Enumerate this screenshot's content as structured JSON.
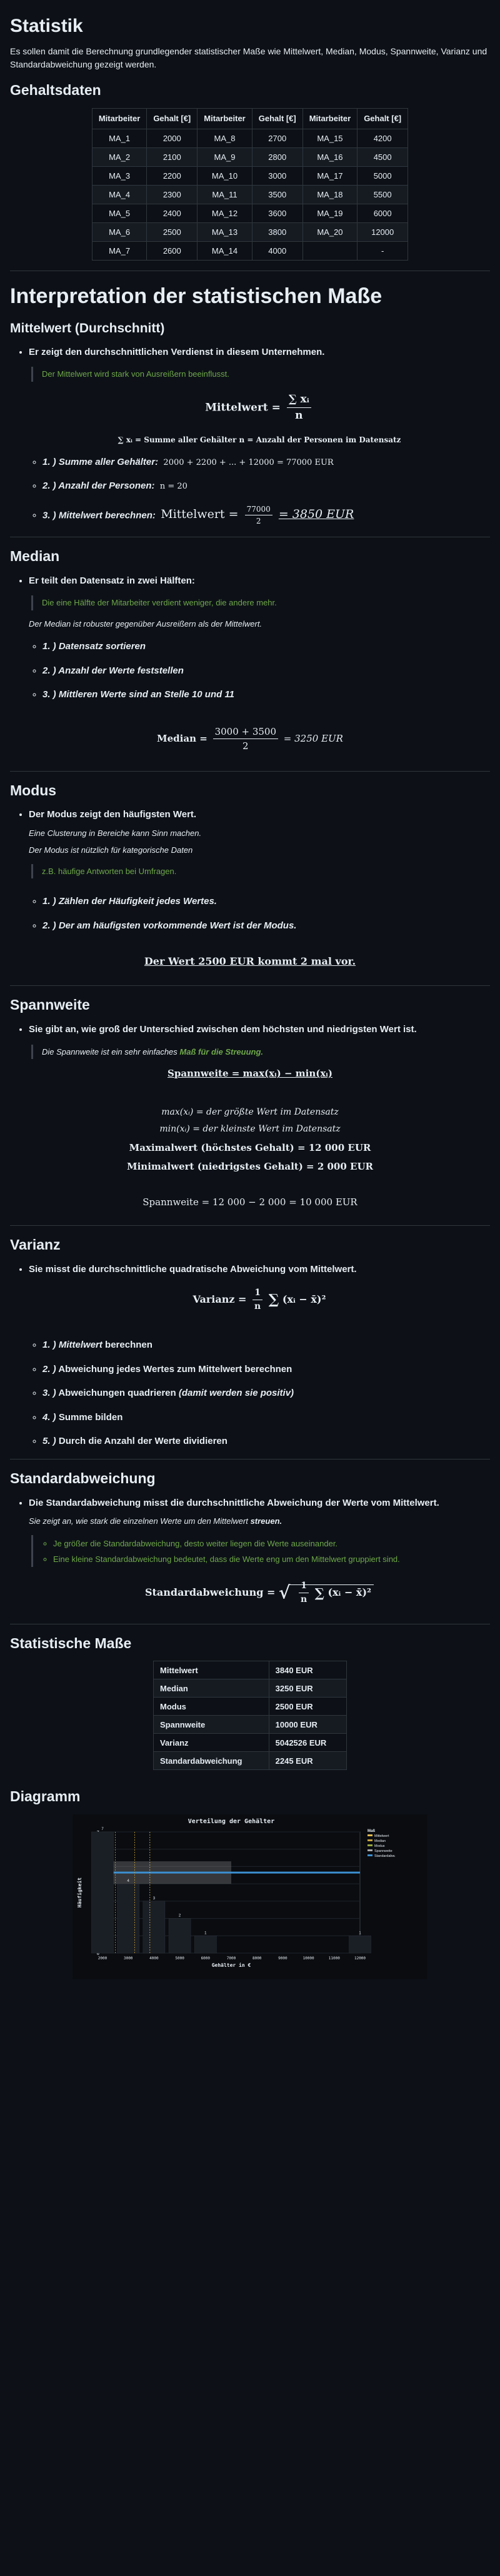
{
  "title": "Statistik",
  "intro": "Es sollen damit die Berechnung grundlegender statistischer Maße wie Mittelwert, Median, Modus, Spannweite, Varianz und Standardabweichung gezeigt werden.",
  "salary_section": {
    "title": "Gehaltsdaten",
    "headers": [
      "Mitarbeiter",
      "Gehalt [€]",
      "Mitarbeiter",
      "Gehalt [€]",
      "Mitarbeiter",
      "Gehalt [€]"
    ],
    "rows": [
      [
        "MA_1",
        "2000",
        "MA_8",
        "2700",
        "MA_15",
        "4200"
      ],
      [
        "MA_2",
        "2100",
        "MA_9",
        "2800",
        "MA_16",
        "4500"
      ],
      [
        "MA_3",
        "2200",
        "MA_10",
        "3000",
        "MA_17",
        "5000"
      ],
      [
        "MA_4",
        "2300",
        "MA_11",
        "3500",
        "MA_18",
        "5500"
      ],
      [
        "MA_5",
        "2400",
        "MA_12",
        "3600",
        "MA_19",
        "6000"
      ],
      [
        "MA_6",
        "2500",
        "MA_13",
        "3800",
        "MA_20",
        "12000"
      ],
      [
        "MA_7",
        "2600",
        "MA_14",
        "4000",
        "",
        "-"
      ]
    ]
  },
  "interpretation_title": "Interpretation der statistischen Maße",
  "mittelwert": {
    "title": "Mittelwert (Durchschnitt)",
    "bullet": "Er zeigt den durchschnittlichen Verdienst in diesem Unternehmen.",
    "quote": "Der Mittelwert wird stark von Ausreißern beeinflusst.",
    "formula_lhs": "Mittelwert",
    "formula_num": "∑ xᵢ",
    "formula_den": "n",
    "legend": "∑ xᵢ = Summe aller Gehälter   n = Anzahl der Personen im Datensatz",
    "steps": [
      {
        "label": "1. ) Summe aller Gehälter:",
        "math": "2000 + 2200 + ... + 12000 = 77000 EUR"
      },
      {
        "label": "2. ) Anzahl der Personen:",
        "math": "n = 20"
      },
      {
        "label": "3. ) Mittelwert berechnen:",
        "lhs": "Mittelwert =",
        "num": "77000",
        "den": "2",
        "rhs": "= 3850 EUR"
      }
    ]
  },
  "median": {
    "title": "Median",
    "bullet": "Er teilt den Datensatz in zwei Hälften:",
    "quote": "Die eine Hälfte der Mitarbeiter verdient weniger, die andere mehr.",
    "note": "Der Median ist robuster gegenüber Ausreißern als der Mittelwert.",
    "steps": [
      "1. ) Datensatz sortieren",
      "2. ) Anzahl der Werte feststellen",
      "3. ) Mittleren Werte sind an Stelle 10 und 11"
    ],
    "formula_lhs": "Median =",
    "formula_num": "3000 + 3500",
    "formula_den": "2",
    "formula_rhs": "= 3250 EUR"
  },
  "modus": {
    "title": "Modus",
    "bullet": "Der Modus zeigt den häufigsten Wert.",
    "note1": "Eine Clusterung in Bereiche kann Sinn machen.",
    "note2": "Der Modus ist nützlich für kategorische Daten",
    "quote": "z.B. häufige Antworten bei Umfragen.",
    "steps": [
      "1. ) Zählen der Häufigkeit jedes Wertes.",
      "2. ) Der am häufigsten vorkommende Wert ist der Modus."
    ],
    "result": "Der Wert 2500 EUR kommt 2 mal vor."
  },
  "spannweite": {
    "title": "Spannweite",
    "bullet": "Sie gibt an, wie groß der Unterschied zwischen dem höchsten und niedrigsten Wert ist.",
    "quote_text": "Die Spannweite ist ein sehr einfaches",
    "quote_strong": "Maß für die Streuung.",
    "formula": "Spannweite = max(xᵢ) − min(xᵢ)",
    "def_max": "max(xᵢ) = der größte Wert im Datensatz",
    "def_min": "min(xᵢ) = der kleinste Wert im Datensatz",
    "max_line": "Maximalwert (höchstes Gehalt) = 12 000 EUR",
    "min_line": "Minimalwert (niedrigstes Gehalt) = 2 000 EUR",
    "result": "Spannweite = 12 000 − 2 000 = 10 000 EUR"
  },
  "varianz": {
    "title": "Varianz",
    "bullet": "Sie misst die durchschnittliche quadratische Abweichung vom Mittelwert.",
    "formula_lhs": "Varianz =",
    "formula_sum": "(xᵢ − x̄)²",
    "steps": [
      {
        "label": "1. )",
        "text": "Mittelwert",
        "suffix": "berechnen"
      },
      {
        "label": "2. )",
        "text": "",
        "suffix": "Abweichung jedes Wertes zum Mittelwert berechnen"
      },
      {
        "label": "3. )",
        "text": "",
        "suffix": "Abweichungen quadrieren",
        "extra": "(damit werden sie positiv)"
      },
      {
        "label": "4. )",
        "text": "",
        "suffix": "Summe bilden"
      },
      {
        "label": "5. )",
        "text": "",
        "suffix": "Durch die Anzahl der Werte dividieren"
      }
    ]
  },
  "std": {
    "title": "Standardabweichung",
    "bullet": "Die Standardabweichung misst die durchschnittliche Abweichung der Werte vom Mittelwert.",
    "note_pre": "Sie zeigt an, wie stark die einzelnen Werte um den Mittelwert",
    "note_strong": "streuen.",
    "quote1": "Je größer die Standardabweichung, desto weiter liegen die Werte auseinander.",
    "quote2": "Eine kleine Standardabweichung bedeutet, dass die Werte eng um den Mittelwert gruppiert sind.",
    "formula_lhs": "Standardabweichung ="
  },
  "measures": {
    "title": "Statistische Maße",
    "rows": [
      [
        "Mittelwert",
        "3840 EUR"
      ],
      [
        "Median",
        "3250 EUR"
      ],
      [
        "Modus",
        "2500 EUR"
      ],
      [
        "Spannweite",
        "10000 EUR"
      ],
      [
        "Varianz",
        "5042526 EUR"
      ],
      [
        "Standardabweichung",
        "2245 EUR"
      ]
    ]
  },
  "diagram_title": "Diagramm",
  "chart_data": {
    "type": "bar",
    "title": "Verteilung der Gehälter",
    "xlabel": "Gehälter in €",
    "ylabel": "Häufigkeit",
    "categories": [
      "2000",
      "3000",
      "4000",
      "5000",
      "6000",
      "7000",
      "8000",
      "9000",
      "10000",
      "11000",
      "12000"
    ],
    "values": [
      7,
      4,
      3,
      2,
      1,
      0,
      0,
      0,
      0,
      0,
      1
    ],
    "ylim": [
      0,
      7
    ],
    "xlim": [
      2000,
      12000
    ],
    "legend_position": "top-right",
    "legend": [
      "Mittelwert",
      "Median",
      "Modus",
      "Spannweite",
      "Standardabw."
    ],
    "legend_colors": [
      "#e0b84a",
      "#c9a33e",
      "#9aa83d",
      "#aaaaaa",
      "#3d8fd0"
    ],
    "annotations": [
      "Spannweite",
      "Standardabweichung"
    ]
  }
}
